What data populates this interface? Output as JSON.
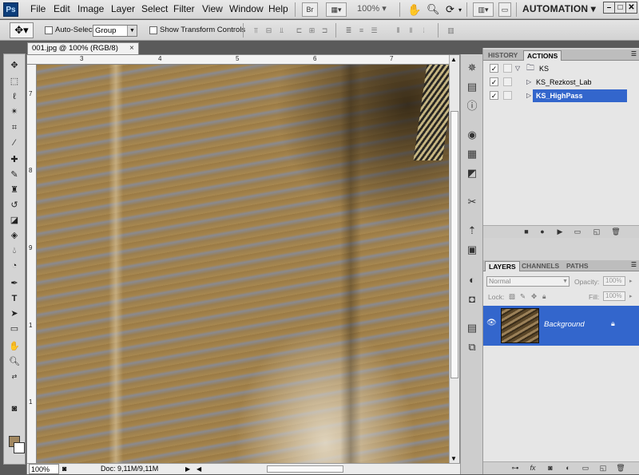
{
  "app": {
    "logo": "Ps",
    "menu": [
      "File",
      "Edit",
      "Image",
      "Layer",
      "Select",
      "Filter",
      "View",
      "Window",
      "Help"
    ],
    "bridge_button": "Br",
    "zoom_level": "100%",
    "workspace": "AUTOMATION",
    "window_controls": {
      "minimize": "–",
      "maximize": "□",
      "close": "✕"
    }
  },
  "options": {
    "auto_select_label": "Auto-Select:",
    "auto_select_value": "Group",
    "show_transform_label": "Show Transform Controls"
  },
  "document": {
    "tab_title": "001.jpg @ 100% (RGB/8)",
    "tab_close": "×",
    "ruler_h": [
      "3",
      "4",
      "5",
      "6",
      "7"
    ],
    "ruler_v": [
      "7",
      "8",
      "9",
      "1",
      "1"
    ],
    "status_zoom": "100%",
    "status_info": "Doc: 9,11M/9,11M"
  },
  "panels": {
    "history_tab": "HISTORY",
    "actions_tab": "ACTIONS",
    "actions": [
      {
        "name": "KS",
        "type": "set"
      },
      {
        "name": "KS_Rezkost_Lab",
        "type": "action"
      },
      {
        "name": "KS_HighPass",
        "type": "action",
        "selected": true
      }
    ],
    "layers_tab": "LAYERS",
    "channels_tab": "CHANNELS",
    "paths_tab": "PATHS",
    "blend_mode": "Normal",
    "opacity_label": "Opacity:",
    "opacity_value": "100%",
    "lock_label": "Lock:",
    "fill_label": "Fill:",
    "fill_value": "100%",
    "layer_name": "Background"
  },
  "colors": {
    "selection_blue": "#3366cc",
    "foreground_color": "#a28860",
    "background_color": "#ffffff"
  }
}
